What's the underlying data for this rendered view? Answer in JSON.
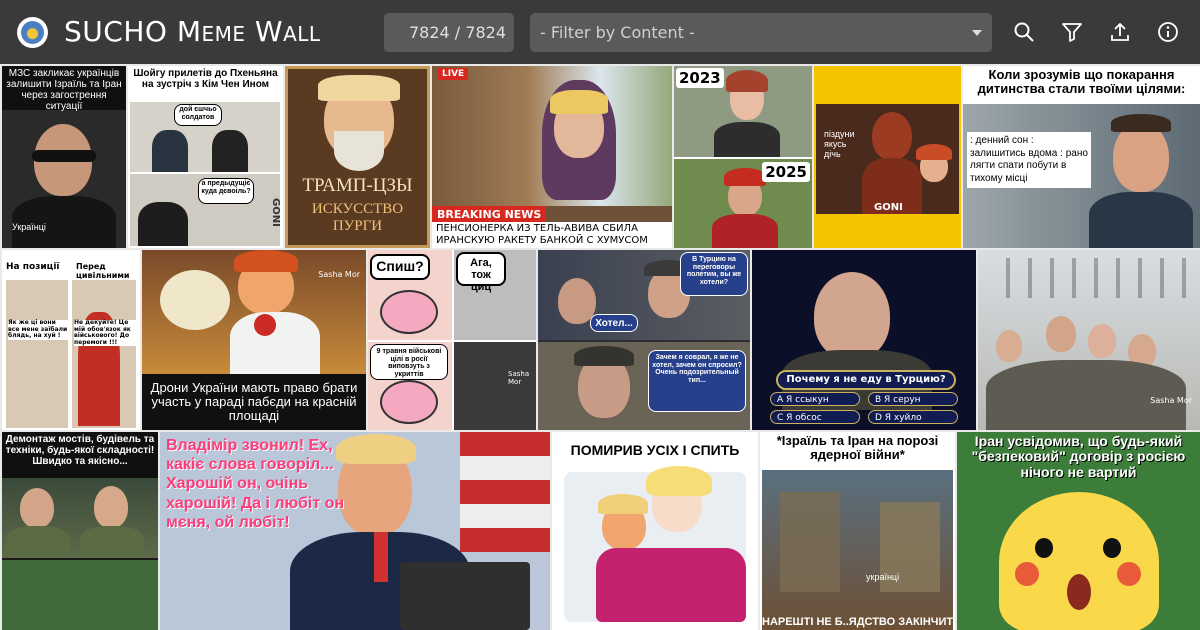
{
  "header": {
    "title": "SUCHO Meme Wall",
    "counter": "7824 / 7824",
    "filter_placeholder": "- Filter by Content -"
  },
  "toolbar": {
    "icons": [
      "search-icon",
      "filter-icon",
      "upload-icon",
      "info-icon"
    ]
  },
  "memes": {
    "m1": {
      "caption": "МЗС закликає українців залишити Ізраїль та Іран через загострення ситуації",
      "label": "Українці"
    },
    "m2": {
      "caption": "Шойгу прилетів до Пхеньяна на зустріч з Кім Чен Ином",
      "bubble1": "дой єшчьо солдатов",
      "bubble2": "а предыдущіє куда дєвоіль?",
      "watermark": "GONI"
    },
    "m3": {
      "line1": "ТРАМП-ЦЗЫ",
      "line2": "ИСКУССТВО ПУРГИ"
    },
    "m4": {
      "live": "LIVE",
      "breaking": "BREAKING NEWS",
      "caption": "ПЕНСИОНЕРКА ИЗ ТЕЛЬ-АВИВА СБИЛА ИРАНСКУЮ РАКЕТУ БАНКОЙ С ХУМУСОМ"
    },
    "m5": {
      "year1": "2023",
      "year2": "2025"
    },
    "m6": {
      "label": "піздуни якусь дічь",
      "watermark": "GONI"
    },
    "m7": {
      "caption": "Коли зрозумів що покарання дитинства стали твоїми цілями:",
      "items": ": денний сон : залишитись вдома : рано лягти спати побути в тихому місці"
    },
    "m8": {
      "left": "На позиції",
      "right": "Перед цивільними",
      "bubble1": "Як же ці вони все мене заїбали блядь, на хуй !",
      "bubble2": "Не декуйте! Це мій обов'язок як військового! До перемоги !!!"
    },
    "m9": {
      "caption": "Дрони України мають право брати участь у параді пабєди на красній площаді",
      "credit": "Sasha Mor"
    },
    "m10": {
      "q": "Спиш?",
      "a": "Ага, тож циц",
      "note": "9 травня військові цілі в росії виповзуть з укриттів",
      "credit": "Sasha Mor"
    },
    "m11": {
      "top": "В Турцию на переговоры полетим, вы же хотели?",
      "mid": "Хотел...",
      "bottom": "Зачем я соврал, я же не хотел, зачем он спросил? Очень подозрительный тип..."
    },
    "m12": {
      "question": "Почему я не еду в Турцию?",
      "a": "А Я ссыкун",
      "b": "B Я серун",
      "c": "C Я обсос",
      "d": "D Я хуйло"
    },
    "m13": {
      "credit": "Sasha Mor"
    },
    "m14": {
      "caption": "Демонтаж мостів, будівель та техніки, будь-якої складності! Швидко та якісно..."
    },
    "m15": {
      "caption": "Владімір звонил! Ех, какіє слова говоріл... Харошій он, очінь харошій! Да і любіт он мєня, ой любіт!"
    },
    "m16": {
      "caption": "ПОМИРИВ УСІХ І СПИТЬ"
    },
    "m17": {
      "caption": "*Ізраїль та Іран на порозі ядерної війни*",
      "label": "українці",
      "bottom": "НАРЕШТІ НЕ Б..ЯДСТВО ЗАКІНЧИТЬСЯ"
    },
    "m18": {
      "caption": "Іран усвідомив, що будь-який \"безпековий\" договір з росією нічого не вартий"
    }
  }
}
